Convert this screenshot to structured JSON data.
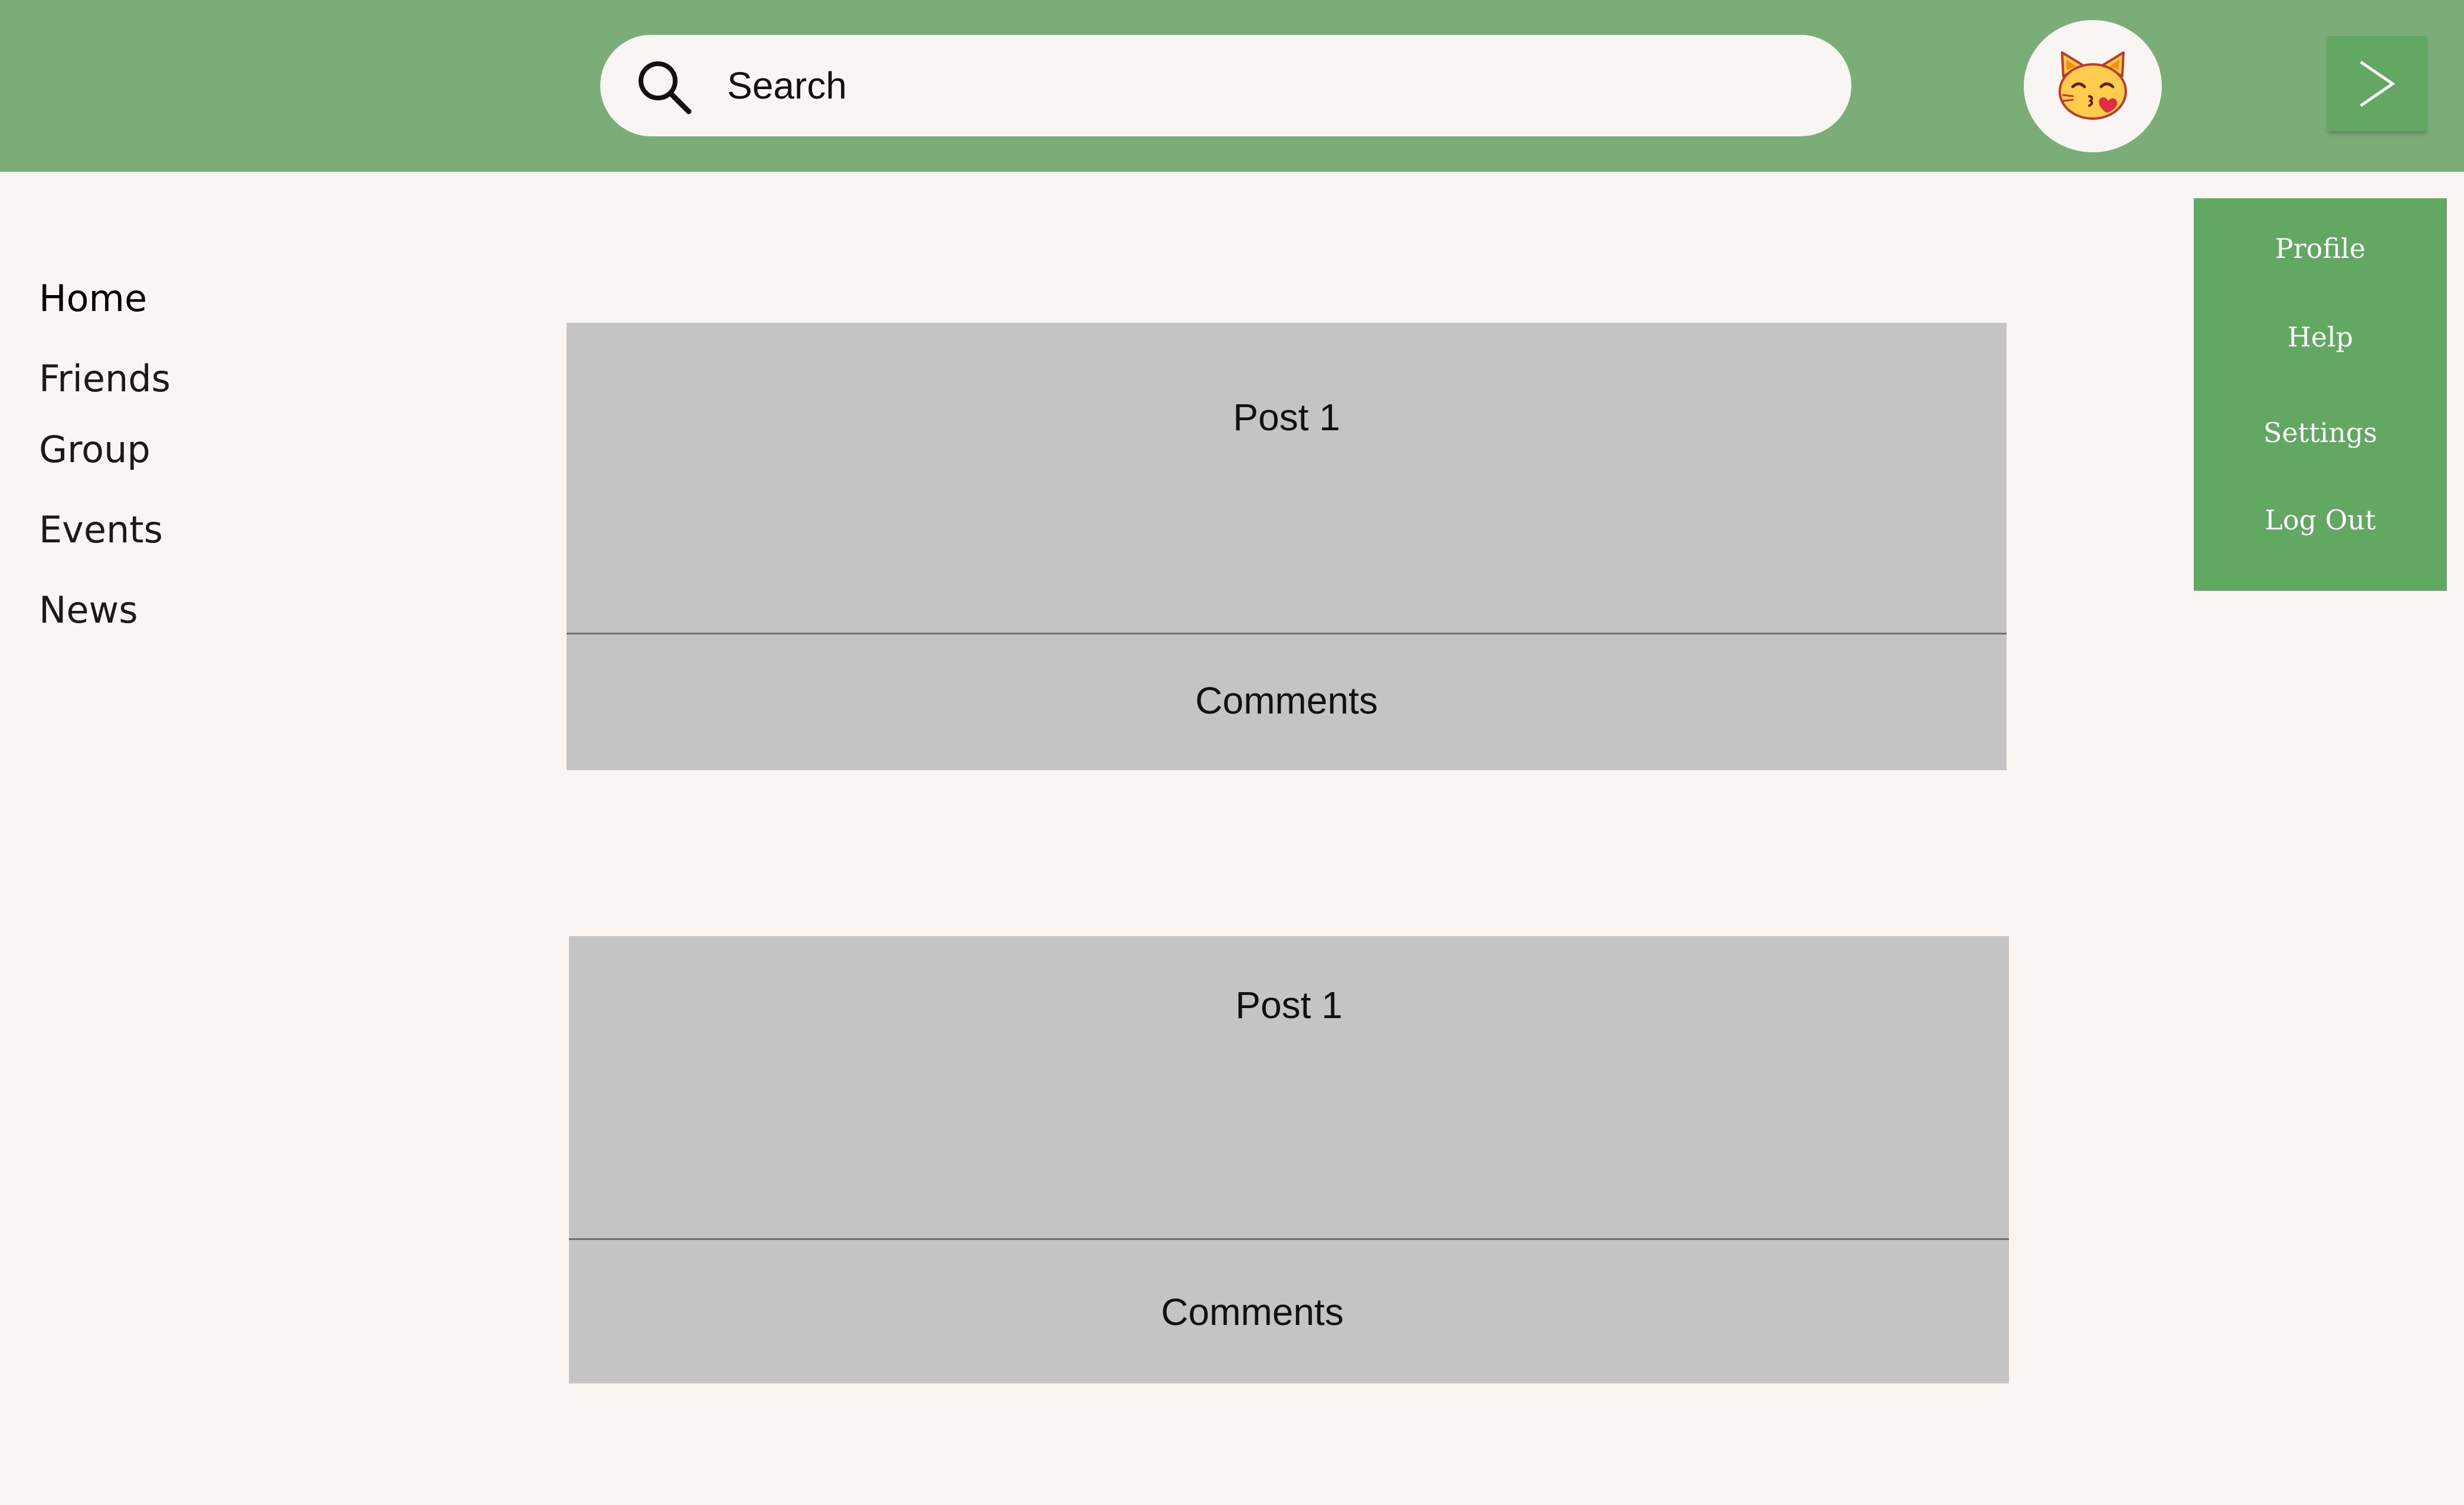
{
  "header": {
    "search": {
      "placeholder": "Search",
      "icon": "search-icon"
    },
    "avatar": {
      "icon": "kissing-cat-emoji",
      "alt": "User avatar"
    },
    "toggle_icon": "chevron-right-icon"
  },
  "nav": {
    "items": [
      {
        "label": "Home",
        "active": true
      },
      {
        "label": "Friends"
      },
      {
        "label": "Group"
      },
      {
        "label": "Events"
      },
      {
        "label": "News"
      }
    ]
  },
  "user_menu": {
    "items": [
      {
        "label": "Profile"
      },
      {
        "label": "Help"
      },
      {
        "label": "Settings"
      },
      {
        "label": "Log Out"
      }
    ]
  },
  "posts": [
    {
      "title": "Post 1",
      "comments_label": "Comments"
    },
    {
      "title": "Post 1",
      "comments_label": "Comments"
    }
  ],
  "colors": {
    "header_bg": "#7aad78",
    "accent": "#62a762",
    "page_bg": "#f9f5f2",
    "card_bg": "#c4c4c4"
  }
}
